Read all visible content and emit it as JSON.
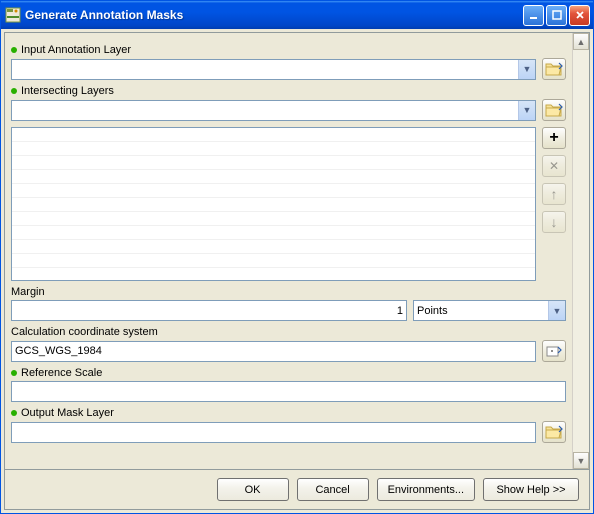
{
  "window": {
    "title": "Generate Annotation Masks"
  },
  "params": {
    "input_annotation_layer": {
      "label": "Input Annotation Layer",
      "value": ""
    },
    "intersecting_layers": {
      "label": "Intersecting Layers",
      "value": ""
    },
    "margin": {
      "label": "Margin",
      "value": "1",
      "unit": "Points"
    },
    "calc_coord_sys": {
      "label": "Calculation coordinate system",
      "value": "GCS_WGS_1984"
    },
    "reference_scale": {
      "label": "Reference Scale",
      "value": ""
    },
    "output_mask_layer": {
      "label": "Output Mask Layer",
      "value": ""
    }
  },
  "buttons": {
    "ok": "OK",
    "cancel": "Cancel",
    "environments": "Environments...",
    "show_help": "Show Help >>"
  },
  "glyphs": {
    "dropdown": "▼",
    "scroll_up": "▲",
    "scroll_down": "▼",
    "plus": "+",
    "remove": "✕",
    "up_arrow": "↑",
    "down_arrow": "↓"
  }
}
